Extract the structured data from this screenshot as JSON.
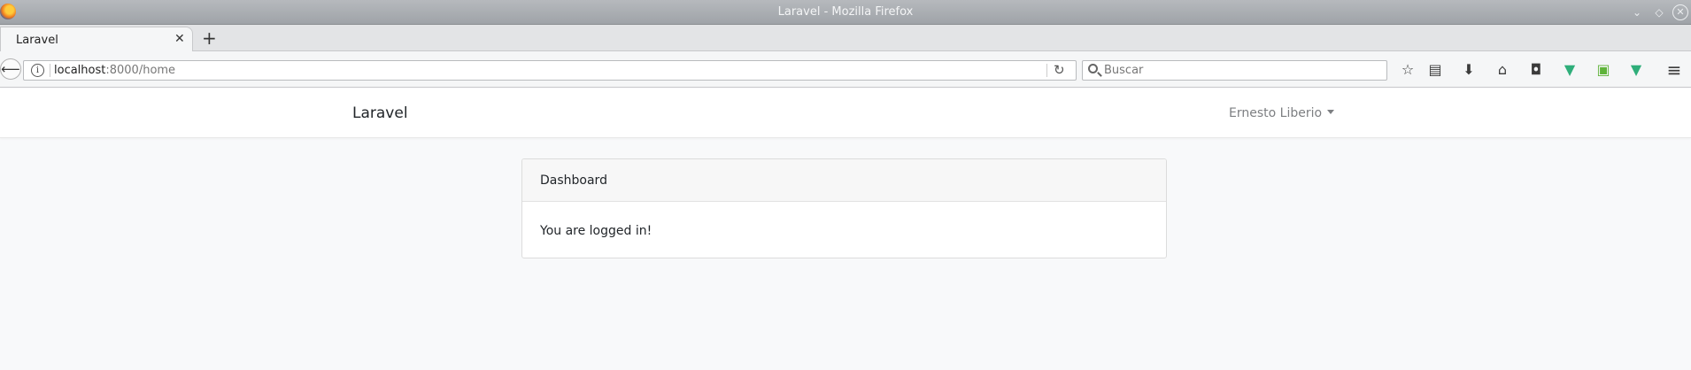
{
  "window": {
    "title": "Laravel - Mozilla Firefox",
    "minimize_glyph": "⌄",
    "maximize_glyph": "◇",
    "close_glyph": "✕"
  },
  "tabs": [
    {
      "label": "Laravel",
      "close_glyph": "✕"
    }
  ],
  "new_tab_glyph": "+",
  "navigation": {
    "back_glyph": "⟵",
    "info_glyph": "i",
    "url_host": "localhost",
    "url_path": ":8000/home",
    "reload_glyph": "↻"
  },
  "search": {
    "placeholder": "Buscar",
    "value": ""
  },
  "toolbar": [
    {
      "name": "bookmark-star-icon",
      "glyph": "☆"
    },
    {
      "name": "reading-list-icon",
      "glyph": "▤"
    },
    {
      "name": "downloads-icon",
      "glyph": "⬇"
    },
    {
      "name": "home-icon",
      "glyph": "⌂"
    },
    {
      "name": "pocket-icon",
      "glyph": "◘"
    },
    {
      "name": "vue-devtools-icon",
      "glyph": "▼",
      "color": "#2fae7a"
    },
    {
      "name": "extension-green-icon",
      "glyph": "▣",
      "color": "#5fb33a"
    },
    {
      "name": "vue-extension-icon",
      "glyph": "▼",
      "color": "#2fae7a"
    },
    {
      "name": "menu-icon",
      "glyph": "≡"
    }
  ],
  "site": {
    "brand": "Laravel",
    "user_name": "Ernesto Liberio"
  },
  "card": {
    "header": "Dashboard",
    "body": "You are logged in!"
  }
}
